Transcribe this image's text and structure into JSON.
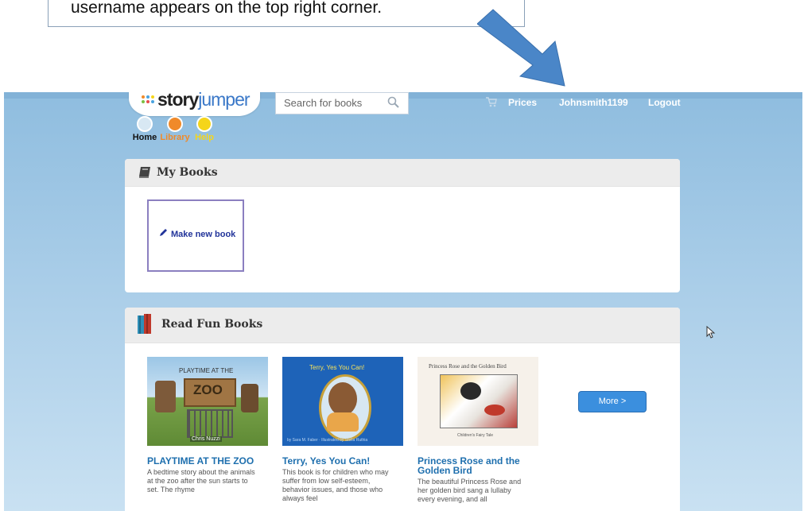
{
  "annotation": {
    "text": "username appears on the top right corner."
  },
  "header": {
    "logo_dark": "story",
    "logo_light": "jumper",
    "search_placeholder": "Search for books",
    "prices": "Prices",
    "username": "Johnsmith1199",
    "logout": "Logout"
  },
  "nav": [
    {
      "label": "Home",
      "color": "#d8e8f3",
      "label_color": "#111111"
    },
    {
      "label": "Library",
      "color": "#f08a2a",
      "label_color": "#f08a2a"
    },
    {
      "label": "Help",
      "color": "#f5d51a",
      "label_color": "#f5d51a"
    }
  ],
  "my_books": {
    "title": "My Books",
    "make_new_label": "Make new book"
  },
  "read_fun": {
    "title": "Read Fun Books",
    "more_label": "More >",
    "books": [
      {
        "title": "PLAYTIME AT THE ZOO",
        "description": "A bedtime story about the animals at the zoo after the sun starts to set. The rhyme",
        "cover_top": "PLAYTIME AT THE",
        "cover_sign": "ZOO",
        "cover_author": "Chris Nuzzi"
      },
      {
        "title": "Terry, Yes You Can!",
        "description": "This book is for children who may suffer from low self-esteem, behavior issues, and those who always feel",
        "cover_top": "Terry, Yes You Can!",
        "cover_author": "by Sara M. Faber · Illustrated by Stella Ruthia"
      },
      {
        "title": "Princess Rose and the Golden Bird",
        "description": "The beautiful Princess Rose and her golden bird sang a lullaby every evening, and all",
        "cover_top": "Princess Rose and the Golden Bird",
        "cover_bottom": "Children's Fairy Tale"
      }
    ]
  },
  "colors": {
    "accent": "#3b8fde",
    "arrow": "#4a86c8",
    "link": "#1e6fae"
  }
}
